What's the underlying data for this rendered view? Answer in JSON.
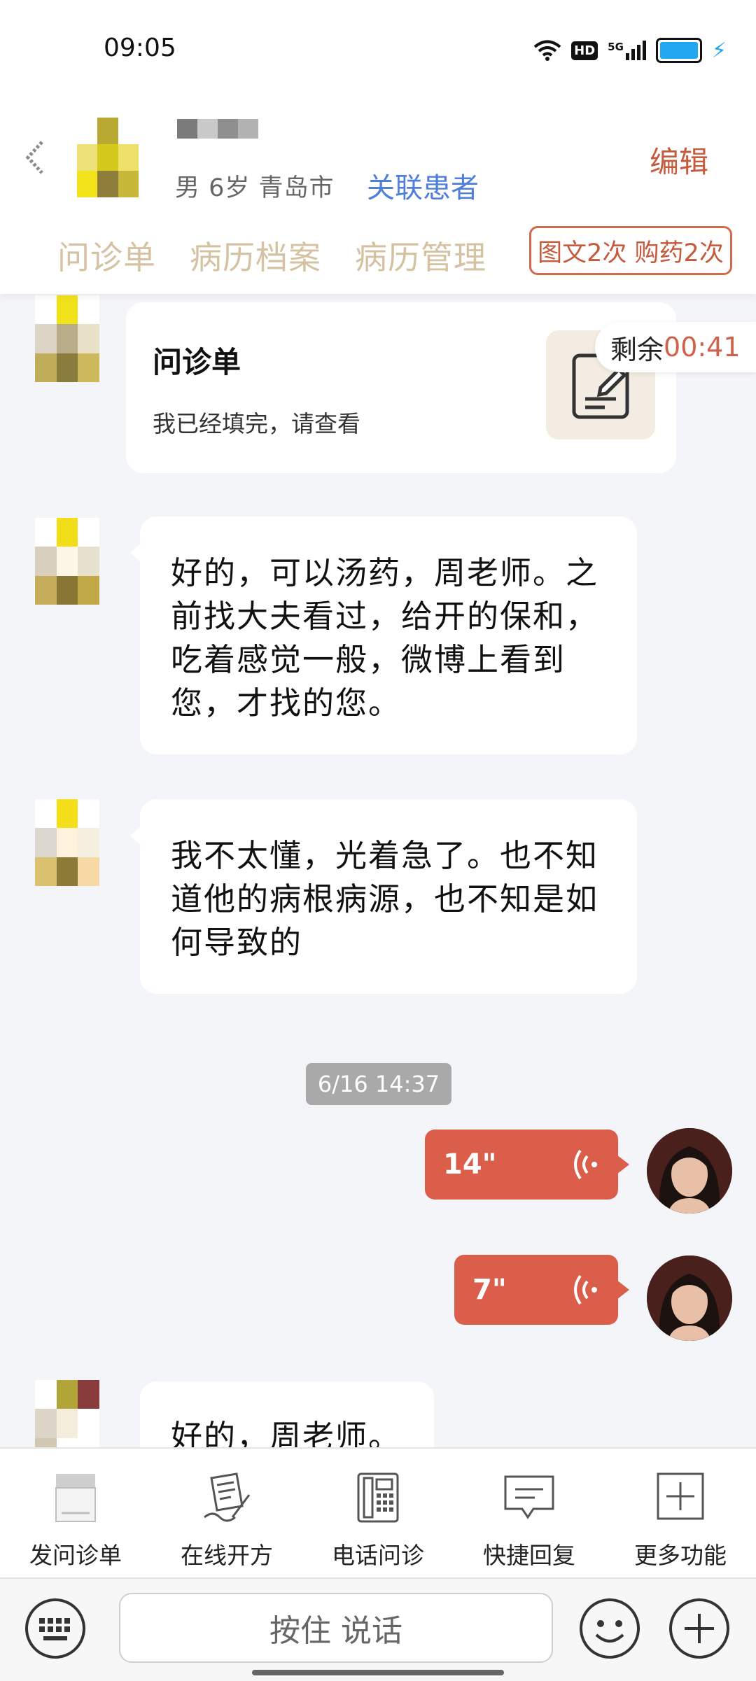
{
  "status_bar": {
    "time": "09:05",
    "network": "5G",
    "hd_label": "HD"
  },
  "header": {
    "patient_info": "男 6岁  青岛市",
    "link_patient": "关联患者",
    "edit": "编辑",
    "tabs": [
      "问诊单",
      "病历档案",
      "病历管理"
    ],
    "quota_badge": "图文2次 购药2次"
  },
  "chat": {
    "timer_label": "剩余",
    "timer_value": "00:41",
    "form_card": {
      "title": "问诊单",
      "desc": "我已经填完，请查看"
    },
    "messages": [
      {
        "lines": [
          "好的，可以汤药，周老师。之",
          "前找大夫看过，给开的保和，",
          "吃着感觉一般，微博上看到",
          "您，才找的您。"
        ]
      },
      {
        "lines": [
          "我不太懂，光着急了。也不知",
          "道他的病根病源，也不知是如",
          "何导致的"
        ]
      },
      {
        "lines": [
          "好的，周老师。"
        ]
      }
    ],
    "timestamp": "6/16 14:37",
    "voice_messages": [
      {
        "duration": "14\""
      },
      {
        "duration": "7\""
      }
    ]
  },
  "toolbar": {
    "items": [
      {
        "label": "发问诊单",
        "icon": "form-icon"
      },
      {
        "label": "在线开方",
        "icon": "prescription-icon"
      },
      {
        "label": "电话问诊",
        "icon": "phone-icon"
      },
      {
        "label": "快捷回复",
        "icon": "quick-reply-icon"
      },
      {
        "label": "更多功能",
        "icon": "more-icon"
      }
    ]
  },
  "input": {
    "hold_to_talk": "按住 说话"
  },
  "colors": {
    "accent_red": "#db5e4b",
    "tab_gold": "#d5c2a3",
    "link_blue": "#4f7fd9",
    "edit_red": "#c55a3d"
  }
}
